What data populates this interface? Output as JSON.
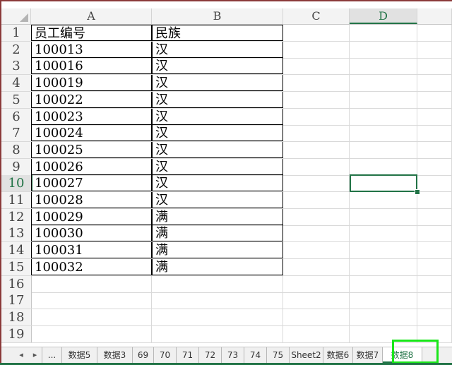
{
  "columns": [
    "A",
    "B",
    "C",
    "D"
  ],
  "active_column": "D",
  "row_numbers": [
    "1",
    "2",
    "3",
    "4",
    "5",
    "6",
    "7",
    "8",
    "9",
    "10",
    "11",
    "12",
    "13",
    "14",
    "15",
    "16",
    "17",
    "18",
    "19"
  ],
  "active_row": "10",
  "table": {
    "headers": [
      "员工编号",
      "民族"
    ],
    "rows": [
      [
        "100013",
        "汉"
      ],
      [
        "100016",
        "汉"
      ],
      [
        "100019",
        "汉"
      ],
      [
        "100022",
        "汉"
      ],
      [
        "100023",
        "汉"
      ],
      [
        "100024",
        "汉"
      ],
      [
        "100025",
        "汉"
      ],
      [
        "100026",
        "汉"
      ],
      [
        "100027",
        "汉"
      ],
      [
        "100028",
        "汉"
      ],
      [
        "100029",
        "满"
      ],
      [
        "100030",
        "满"
      ],
      [
        "100031",
        "满"
      ],
      [
        "100032",
        "满"
      ]
    ]
  },
  "sheet_nav": {
    "prev": "◂",
    "next": "▸",
    "more": "..."
  },
  "sheet_tabs": [
    "数据5",
    "数据3",
    "69",
    "70",
    "71",
    "72",
    "73",
    "74",
    "75",
    "Sheet2",
    "数据6",
    "数据7",
    "数据8"
  ],
  "active_sheet": "数据8",
  "colors": {
    "accent": "#217346",
    "highlight": "#19e619"
  }
}
